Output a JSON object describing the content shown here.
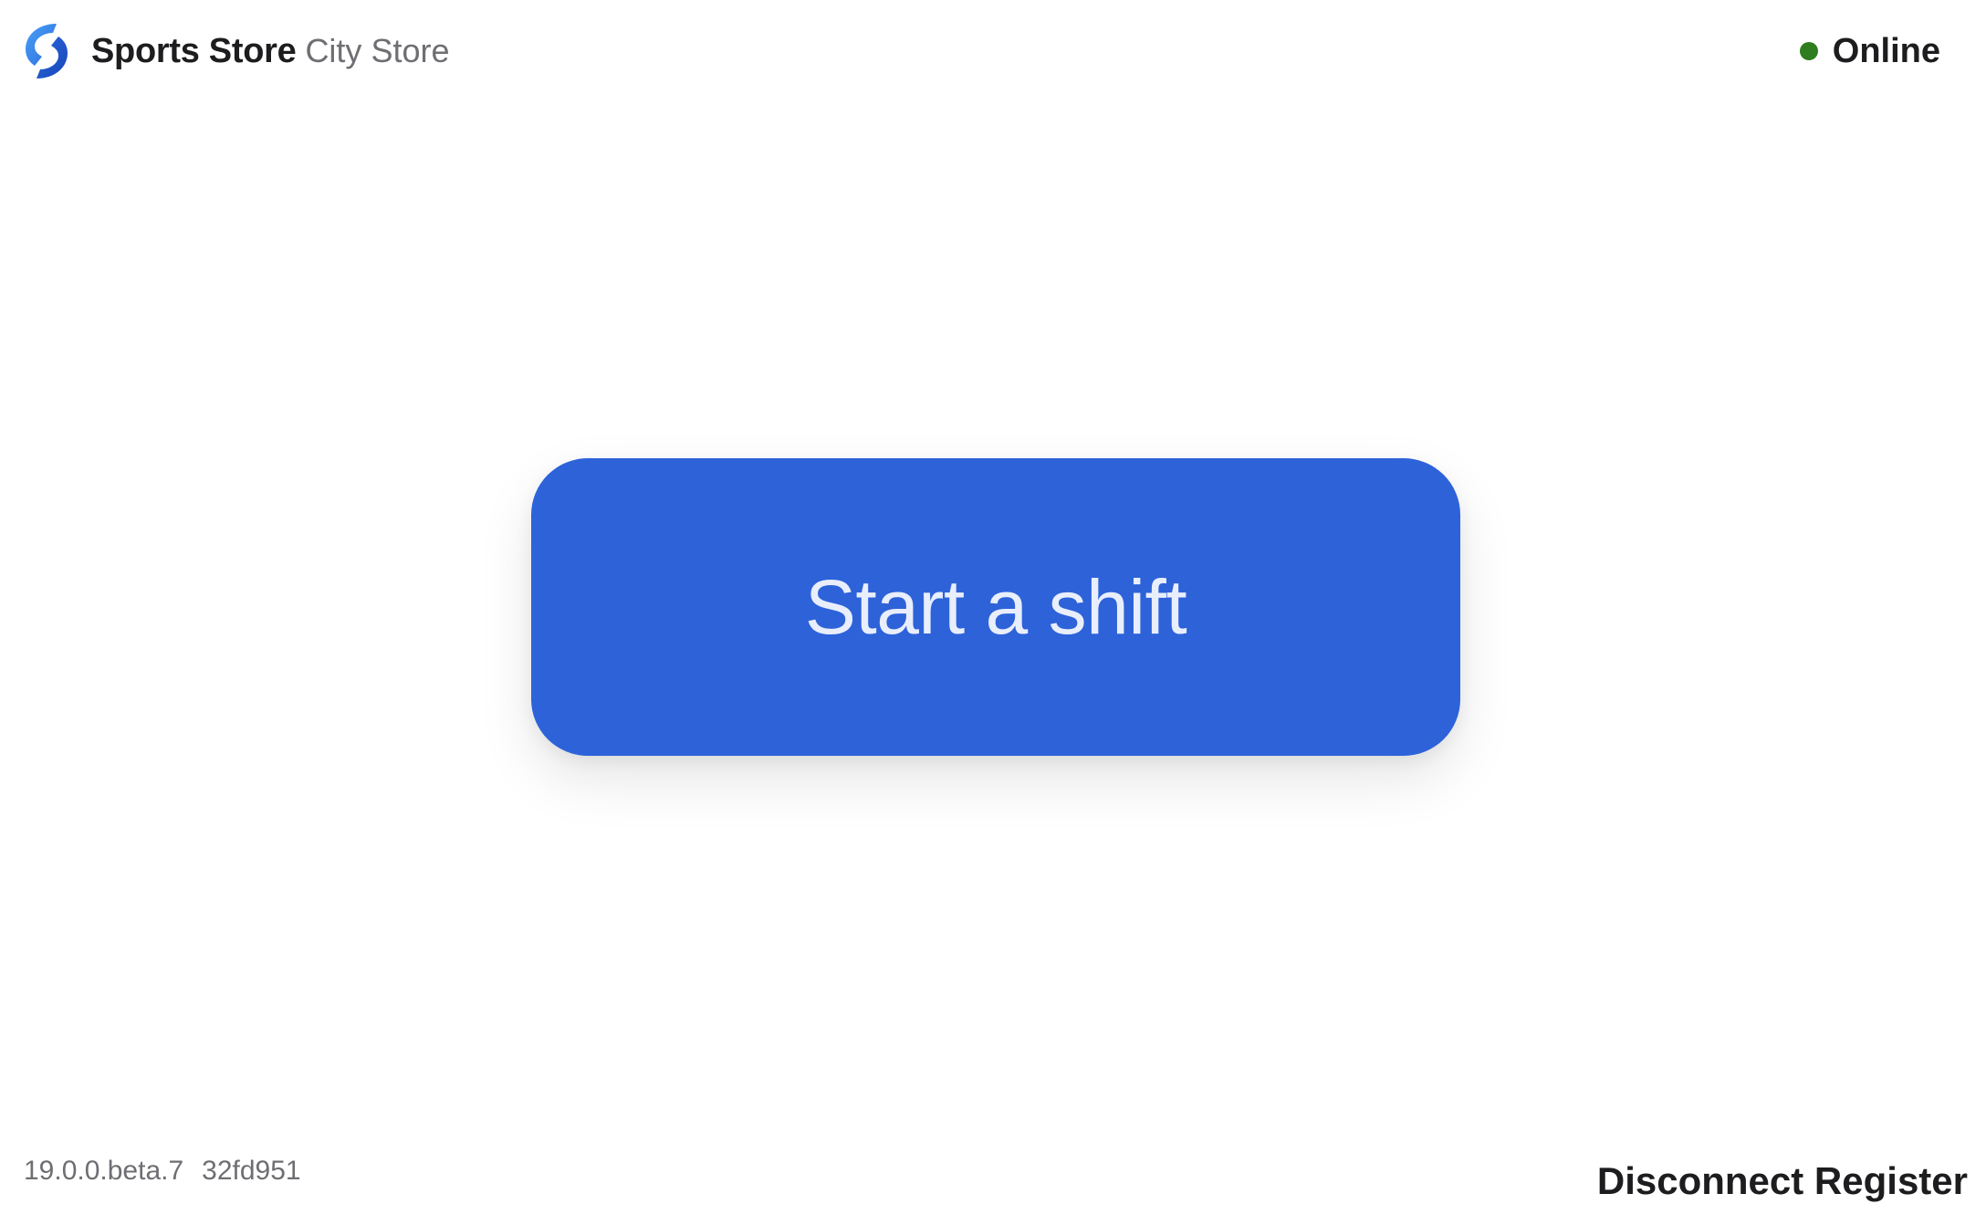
{
  "header": {
    "logo_icon": "store-logo-icon",
    "store_name": "Sports Store",
    "store_location": "City Store"
  },
  "status": {
    "label": "Online",
    "color": "#2e7d1f"
  },
  "main": {
    "start_shift_label": "Start a shift",
    "accent": "#2d62d9"
  },
  "footer": {
    "version": "19.0.0.beta.7",
    "build": "32fd951",
    "disconnect_label": "Disconnect Register"
  }
}
